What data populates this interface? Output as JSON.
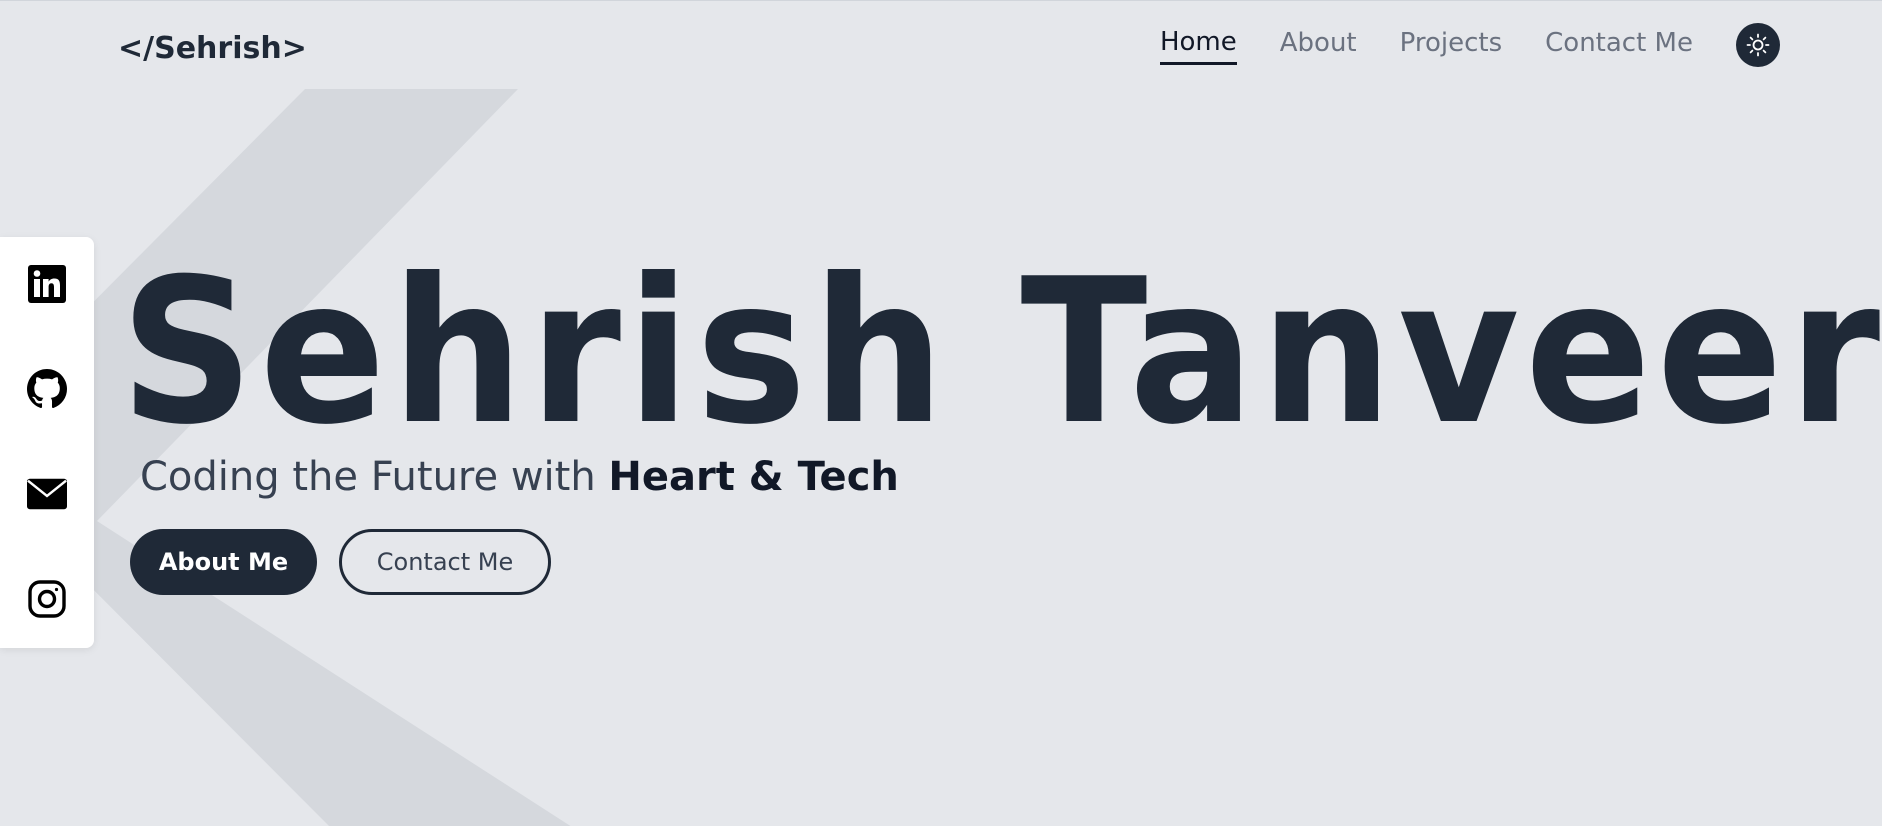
{
  "header": {
    "logo": "</Sehrish>",
    "nav": [
      {
        "label": "Home",
        "active": true
      },
      {
        "label": "About",
        "active": false
      },
      {
        "label": "Projects",
        "active": false
      },
      {
        "label": "Contact Me",
        "active": false
      }
    ],
    "theme_toggle_icon": "sun-icon"
  },
  "social": [
    {
      "icon": "linkedin-icon"
    },
    {
      "icon": "github-icon"
    },
    {
      "icon": "mail-icon"
    },
    {
      "icon": "instagram-icon"
    }
  ],
  "hero": {
    "name": "Sehrish Tanveer",
    "tagline_prefix": "Coding the Future with ",
    "tagline_emphasis": "Heart & Tech",
    "primary_button": "About Me",
    "secondary_button": "Contact Me"
  },
  "colors": {
    "background": "#e5e7eb",
    "text_dark": "#1f2937",
    "nav_inactive": "#6b7280",
    "chevron": "#d1d5db"
  }
}
